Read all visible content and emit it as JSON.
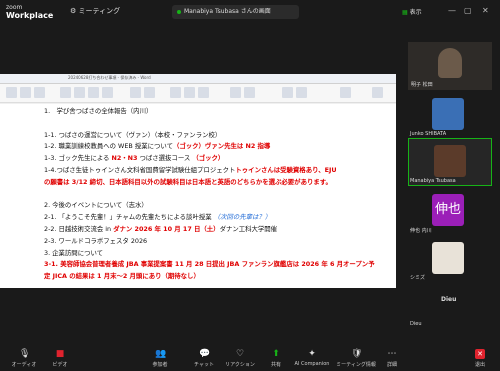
{
  "app": {
    "name_top": "zoom",
    "name_bottom": "Workplace"
  },
  "top": {
    "meeting_label": "ミーティング",
    "share_label": "Manabiya Tsubasa さんの画面",
    "view_label": "表示"
  },
  "doc": {
    "title": "20240628打ち合わせ事項 - 保存済み - Word",
    "lines": [
      {
        "segs": [
          {
            "t": "1.　学び舎つばさの全体報告（内川）",
            "c": ""
          }
        ]
      },
      {
        "segs": [
          {
            "t": "",
            "c": ""
          }
        ]
      },
      {
        "segs": [
          {
            "t": "1-1. つばさの運営について（ヴァン）（本校・ファンラン校）",
            "c": ""
          }
        ]
      },
      {
        "segs": [
          {
            "t": "1-2. 職業訓練校教員への WEB 授業について",
            "c": ""
          },
          {
            "t": "（ゴック）ヴァン先生は N2 指導",
            "c": "red"
          }
        ]
      },
      {
        "segs": [
          {
            "t": "1-3. ゴック先生による ",
            "c": ""
          },
          {
            "t": "N2・N3",
            "c": "red"
          },
          {
            "t": " つばさ選抜コース ",
            "c": ""
          },
          {
            "t": "（ゴック）",
            "c": "red"
          }
        ]
      },
      {
        "segs": [
          {
            "t": "1-4.つばさ生徒トゥインさん文科省国費留学試験仕組プロジェクト",
            "c": ""
          },
          {
            "t": "トゥインさんは受験資格あり、EJU",
            "c": "red"
          }
        ]
      },
      {
        "segs": [
          {
            "t": "の願書は 3/12 締切、日本語科目以外の試験科目は日本語と英語のどちらかを選ぶ必要があります。",
            "c": "red"
          }
        ]
      },
      {
        "segs": [
          {
            "t": "",
            "c": ""
          }
        ]
      },
      {
        "segs": [
          {
            "t": "2. 今後のイベントについて（志水）",
            "c": ""
          }
        ]
      },
      {
        "segs": [
          {
            "t": "2-1. 「ようこそ先輩！」チャムの先輩たちによる談叶授業 ",
            "c": ""
          },
          {
            "t": "（次回の先輩は？）",
            "c": "blue"
          }
        ]
      },
      {
        "segs": [
          {
            "t": "2-2. 日越技術交流会 in ",
            "c": ""
          },
          {
            "t": "ダナン 2026 年 10 月 17 日（土）",
            "c": "red"
          },
          {
            "t": "ダナン工科大学開催",
            "c": ""
          }
        ]
      },
      {
        "segs": [
          {
            "t": "2-3. ワールドコラボフェスタ 2026",
            "c": ""
          }
        ]
      },
      {
        "segs": [
          {
            "t": "3. 企業訪問について",
            "c": ""
          }
        ]
      },
      {
        "segs": [
          {
            "t": "3-1. 美容師協会普理者養成 JBA 事業提案書 11 月 28 日提出 JBA ファンラン旗艦店は 2026 年 6 月オープン予",
            "c": "red"
          }
        ]
      },
      {
        "segs": [
          {
            "t": "定 JICA の結果は 1 月末〜2 月頭にあり（期待なし）",
            "c": "red"
          }
        ]
      }
    ]
  },
  "participants": [
    {
      "name": "明子 松田",
      "avatar": ""
    },
    {
      "name": "Junko SHIBATA",
      "avatar": ""
    },
    {
      "name": "Manabiya Tsubasa",
      "avatar": ""
    },
    {
      "name": "伸也 内川",
      "avatar": "伸也"
    },
    {
      "name": "シミズ",
      "avatar": ""
    },
    {
      "name": "Dieu",
      "avatar": ""
    },
    {
      "name": "Dieu",
      "avatar": ""
    }
  ],
  "colors": {
    "accent": "#17b317",
    "purple": "#9b1fb8",
    "red_btn": "#e0232e"
  },
  "bottom": [
    {
      "label": "オーディオ",
      "icon": "microphone-icon"
    },
    {
      "label": "ビデオ",
      "icon": "video-icon"
    },
    {
      "label": "参加者",
      "icon": "participants-icon",
      "count": "7"
    },
    {
      "label": "チャット",
      "icon": "chat-icon"
    },
    {
      "label": "リアクション",
      "icon": "reaction-icon"
    },
    {
      "label": "共有",
      "icon": "share-icon"
    },
    {
      "label": "AI Companion",
      "icon": "ai-companion-icon"
    },
    {
      "label": "ミーティング情報",
      "icon": "info-icon"
    },
    {
      "label": "詳細",
      "icon": "more-icon"
    },
    {
      "label": "退出",
      "icon": "leave-icon"
    }
  ]
}
